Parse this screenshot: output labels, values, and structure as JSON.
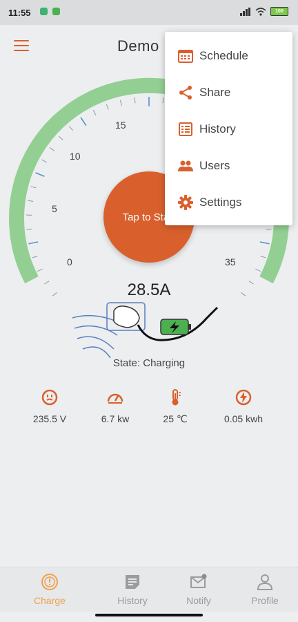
{
  "status_bar": {
    "time": "11:55",
    "battery": "100"
  },
  "app_bar": {
    "title": "Demo",
    "menu_icon": "hamburger-icon"
  },
  "gauge": {
    "tick_labels": [
      "0",
      "5",
      "10",
      "15",
      "35"
    ],
    "button_label": "Tap to Start",
    "current": "28.5A",
    "state": "State: Charging",
    "colors": {
      "arc": "#93cf93",
      "accent": "#d9602d"
    }
  },
  "metrics": [
    {
      "icon": "socket-icon",
      "value": "235.5 V"
    },
    {
      "icon": "speedometer-icon",
      "value": "6.7 kw"
    },
    {
      "icon": "thermometer-icon",
      "value": "25 ℃"
    },
    {
      "icon": "energy-icon",
      "value": "0.05 kwh"
    }
  ],
  "menu": {
    "items": [
      {
        "icon": "calendar-icon",
        "label": "Schedule"
      },
      {
        "icon": "share-icon",
        "label": "Share"
      },
      {
        "icon": "history-list-icon",
        "label": "History"
      },
      {
        "icon": "users-icon",
        "label": "Users"
      },
      {
        "icon": "gear-icon",
        "label": "Settings"
      }
    ]
  },
  "bottom_nav": {
    "items": [
      {
        "icon": "charge-icon",
        "label": "Charge",
        "active": true
      },
      {
        "icon": "history-icon",
        "label": "History"
      },
      {
        "icon": "notify-icon",
        "label": "Notify"
      },
      {
        "icon": "profile-icon",
        "label": "Profile"
      }
    ]
  }
}
